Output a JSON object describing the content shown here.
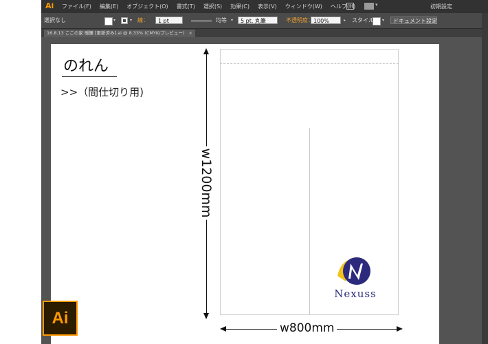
{
  "app": {
    "logo": "Ai",
    "menus": [
      "ファイル(F)",
      "編集(E)",
      "オブジェクト(O)",
      "書式(T)",
      "選択(S)",
      "効果(C)",
      "表示(V)",
      "ウィンドウ(W)",
      "ヘルプ(H)"
    ],
    "workspace": "初期設定"
  },
  "controlbar": {
    "selection": "選択なし",
    "stroke_label": "線：",
    "stroke_weight": "1 pt",
    "stroke_profile": "均等",
    "brush": "5 pt. 丸筆",
    "opacity_label": "不透明度：",
    "opacity_value": "100%",
    "style_label": "スタイル：",
    "doc_setup_button": "ドキュメント設定"
  },
  "document_tab": {
    "title": "16.8.13 ここの家 暖簾 [更新済み].ai @ 8.33% (CMYK/プレビュー)",
    "close": "×"
  },
  "artwork": {
    "title": "のれん",
    "subtitle": ">>（間仕切り用)",
    "height_label": "w1200mm",
    "width_label": "w800mm",
    "brand": "Nexuss"
  },
  "badge": {
    "text": "Ai"
  }
}
